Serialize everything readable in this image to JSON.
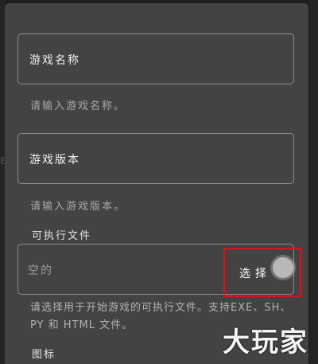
{
  "fields": {
    "name": {
      "label": "游戏名称",
      "helper": "请输入游戏名称。"
    },
    "version": {
      "label": "游戏版本",
      "helper": "请输入游戏版本。"
    }
  },
  "executable": {
    "title": "可执行文件",
    "value": "空的",
    "select_label": "选择",
    "help": "请选择用于开始游戏的可执行文件。支持EXE、SH、PY 和 HTML 文件。"
  },
  "icon_section": {
    "title": "图标"
  },
  "watermark": "大玩家",
  "backdrop": {
    "stray_char": "E"
  },
  "colors": {
    "dialog_bg": "#434344",
    "outline": "#8e8e8e",
    "highlight": "#d6161c"
  }
}
